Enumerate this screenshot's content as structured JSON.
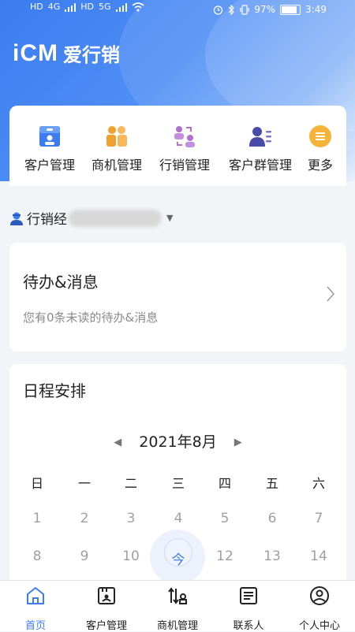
{
  "status_bar": {
    "left_labels": [
      "HD",
      "4G",
      "HD",
      "5G"
    ],
    "battery_percent": "97%",
    "battery_level": 0.97,
    "time": "3:49"
  },
  "header": {
    "logo_mark": "iCM",
    "app_name": "爱行销"
  },
  "quick_menu": [
    {
      "label": "客户管理",
      "icon": "customer-card-icon"
    },
    {
      "label": "商机管理",
      "icon": "opportunity-people-icon"
    },
    {
      "label": "行销管理",
      "icon": "marketing-people-icon"
    },
    {
      "label": "客户群管理",
      "icon": "customer-group-icon"
    },
    {
      "label": "更多",
      "icon": "more-menu-icon"
    }
  ],
  "manager": {
    "label": "行销经"
  },
  "todo_card": {
    "title": "待办&消息",
    "subtitle": "您有0条未读的待办&消息"
  },
  "schedule": {
    "title": "日程安排",
    "month": "2021年8月",
    "weekdays": [
      "日",
      "一",
      "二",
      "三",
      "四",
      "五",
      "六"
    ],
    "week1": [
      "1",
      "2",
      "3",
      "4",
      "5",
      "6",
      "7"
    ],
    "week2": [
      "8",
      "9",
      "10",
      "今",
      "12",
      "13",
      "14"
    ]
  },
  "tabbar": [
    {
      "label": "首页",
      "icon": "home-icon",
      "active": true
    },
    {
      "label": "客户管理",
      "icon": "customer-icon",
      "active": false
    },
    {
      "label": "商机管理",
      "icon": "opportunity-icon",
      "active": false
    },
    {
      "label": "联系人",
      "icon": "contacts-icon",
      "active": false
    },
    {
      "label": "个人中心",
      "icon": "profile-icon",
      "active": false
    }
  ],
  "colors": {
    "primary": "#3b7cf0",
    "orange": "#f0a030",
    "purple": "#b070d0",
    "navy": "#4a4aa8"
  }
}
